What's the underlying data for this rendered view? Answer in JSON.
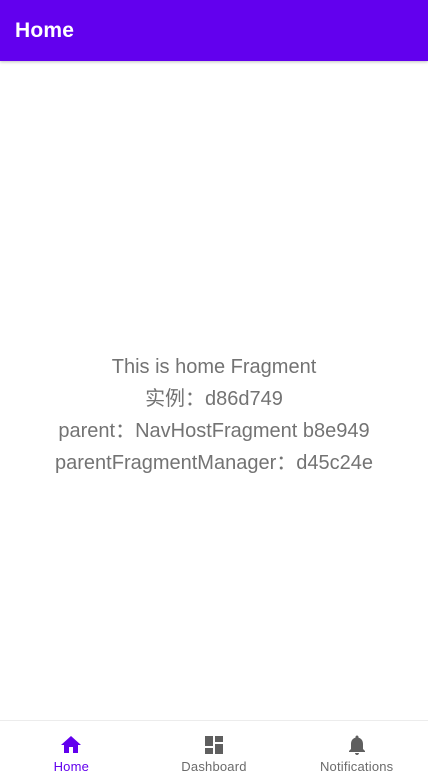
{
  "app_bar": {
    "title": "Home"
  },
  "main": {
    "lines": [
      "This is home Fragment",
      "实例：d86d749",
      "parent：NavHostFragment b8e949",
      "parentFragmentManager：d45c24e"
    ]
  },
  "bottom_nav": {
    "items": [
      {
        "label": "Home",
        "icon": "home-icon",
        "selected": true
      },
      {
        "label": "Dashboard",
        "icon": "dashboard-icon",
        "selected": false
      },
      {
        "label": "Notifications",
        "icon": "bell-icon",
        "selected": false
      }
    ]
  },
  "colors": {
    "primary": "#6200EE",
    "text": "#737373",
    "nav_inactive_icon": "#5f5f5f",
    "nav_inactive_label": "#6b6b6b"
  }
}
